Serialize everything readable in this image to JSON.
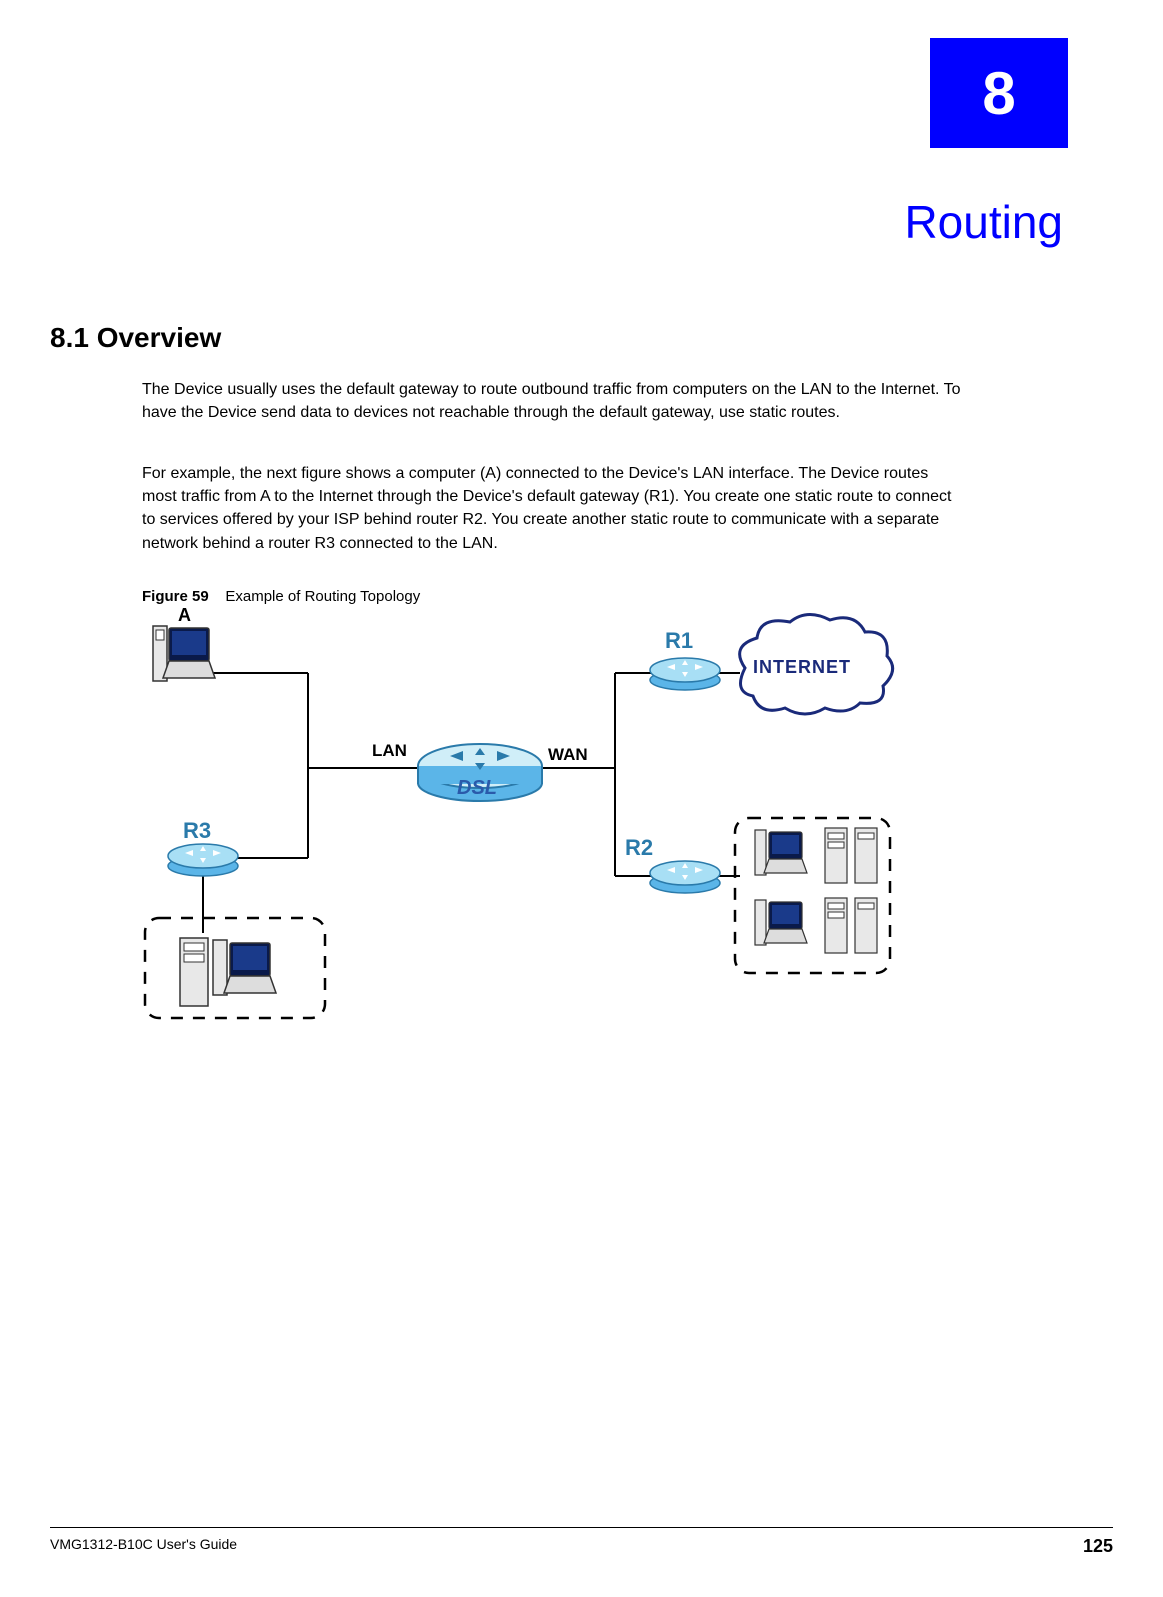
{
  "chapter": {
    "number": "8",
    "title": "Routing"
  },
  "section": {
    "number": "8.1",
    "title": "Overview",
    "full": "8.1  Overview"
  },
  "paragraphs": {
    "p1": "The Device usually uses the default gateway to route outbound traffic from computers on the LAN to the Internet. To have the Device send data to devices not reachable through the default gateway, use static routes.",
    "p2": "For example, the next figure shows a computer (A) connected to the Device's LAN interface. The Device routes most traffic from A to the Internet through the Device's default gateway (R1). You create one static route to connect to services offered by your ISP behind router R2. You create another static route to communicate with a separate network behind a router R3 connected to the LAN."
  },
  "figure": {
    "label": "Figure 59",
    "caption": "Example of Routing Topology",
    "nodes": {
      "A": "A",
      "R1": "R1",
      "R2": "R2",
      "R3": "R3",
      "LAN": "LAN",
      "WAN": "WAN",
      "DSL": "DSL",
      "INTERNET": "INTERNET"
    }
  },
  "footer": {
    "left": "VMG1312-B10C User's Guide",
    "page": "125"
  }
}
